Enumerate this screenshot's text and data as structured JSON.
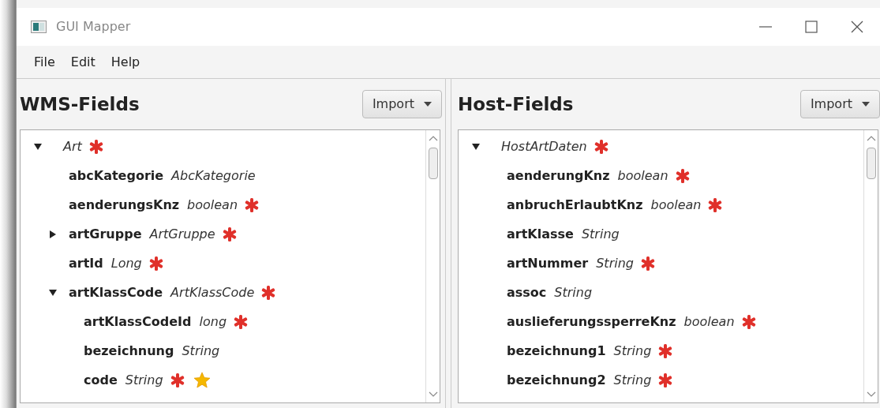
{
  "window": {
    "title": "GUI Mapper"
  },
  "menu": [
    "File",
    "Edit",
    "Help"
  ],
  "panels": [
    {
      "title": "WMS-Fields",
      "import_button": "Import",
      "tree": [
        {
          "type": "Art",
          "required": true,
          "expanded": true,
          "children": [
            {
              "name": "abcKategorie",
              "type": "AbcKategorie",
              "required": false
            },
            {
              "name": "aenderungsKnz",
              "type": "boolean",
              "required": true
            },
            {
              "name": "artGruppe",
              "type": "ArtGruppe",
              "required": true,
              "expanded": false
            },
            {
              "name": "artId",
              "type": "Long",
              "required": true
            },
            {
              "name": "artKlassCode",
              "type": "ArtKlassCode",
              "required": true,
              "expanded": true,
              "children": [
                {
                  "name": "artKlassCodeId",
                  "type": "long",
                  "required": true
                },
                {
                  "name": "bezeichnung",
                  "type": "String",
                  "required": false
                },
                {
                  "name": "code",
                  "type": "String",
                  "required": true,
                  "starred": true
                }
              ]
            }
          ]
        }
      ]
    },
    {
      "title": "Host-Fields",
      "import_button": "Import",
      "tree": [
        {
          "type": "HostArtDaten",
          "required": true,
          "expanded": true,
          "children": [
            {
              "name": "aenderungKnz",
              "type": "boolean",
              "required": true
            },
            {
              "name": "anbruchErlaubtKnz",
              "type": "boolean",
              "required": true
            },
            {
              "name": "artKlasse",
              "type": "String",
              "required": false
            },
            {
              "name": "artNummer",
              "type": "String",
              "required": true
            },
            {
              "name": "assoc",
              "type": "String",
              "required": false
            },
            {
              "name": "auslieferungssperreKnz",
              "type": "boolean",
              "required": true
            },
            {
              "name": "bezeichnung1",
              "type": "String",
              "required": true
            },
            {
              "name": "bezeichnung2",
              "type": "String",
              "required": true
            }
          ]
        }
      ]
    }
  ]
}
